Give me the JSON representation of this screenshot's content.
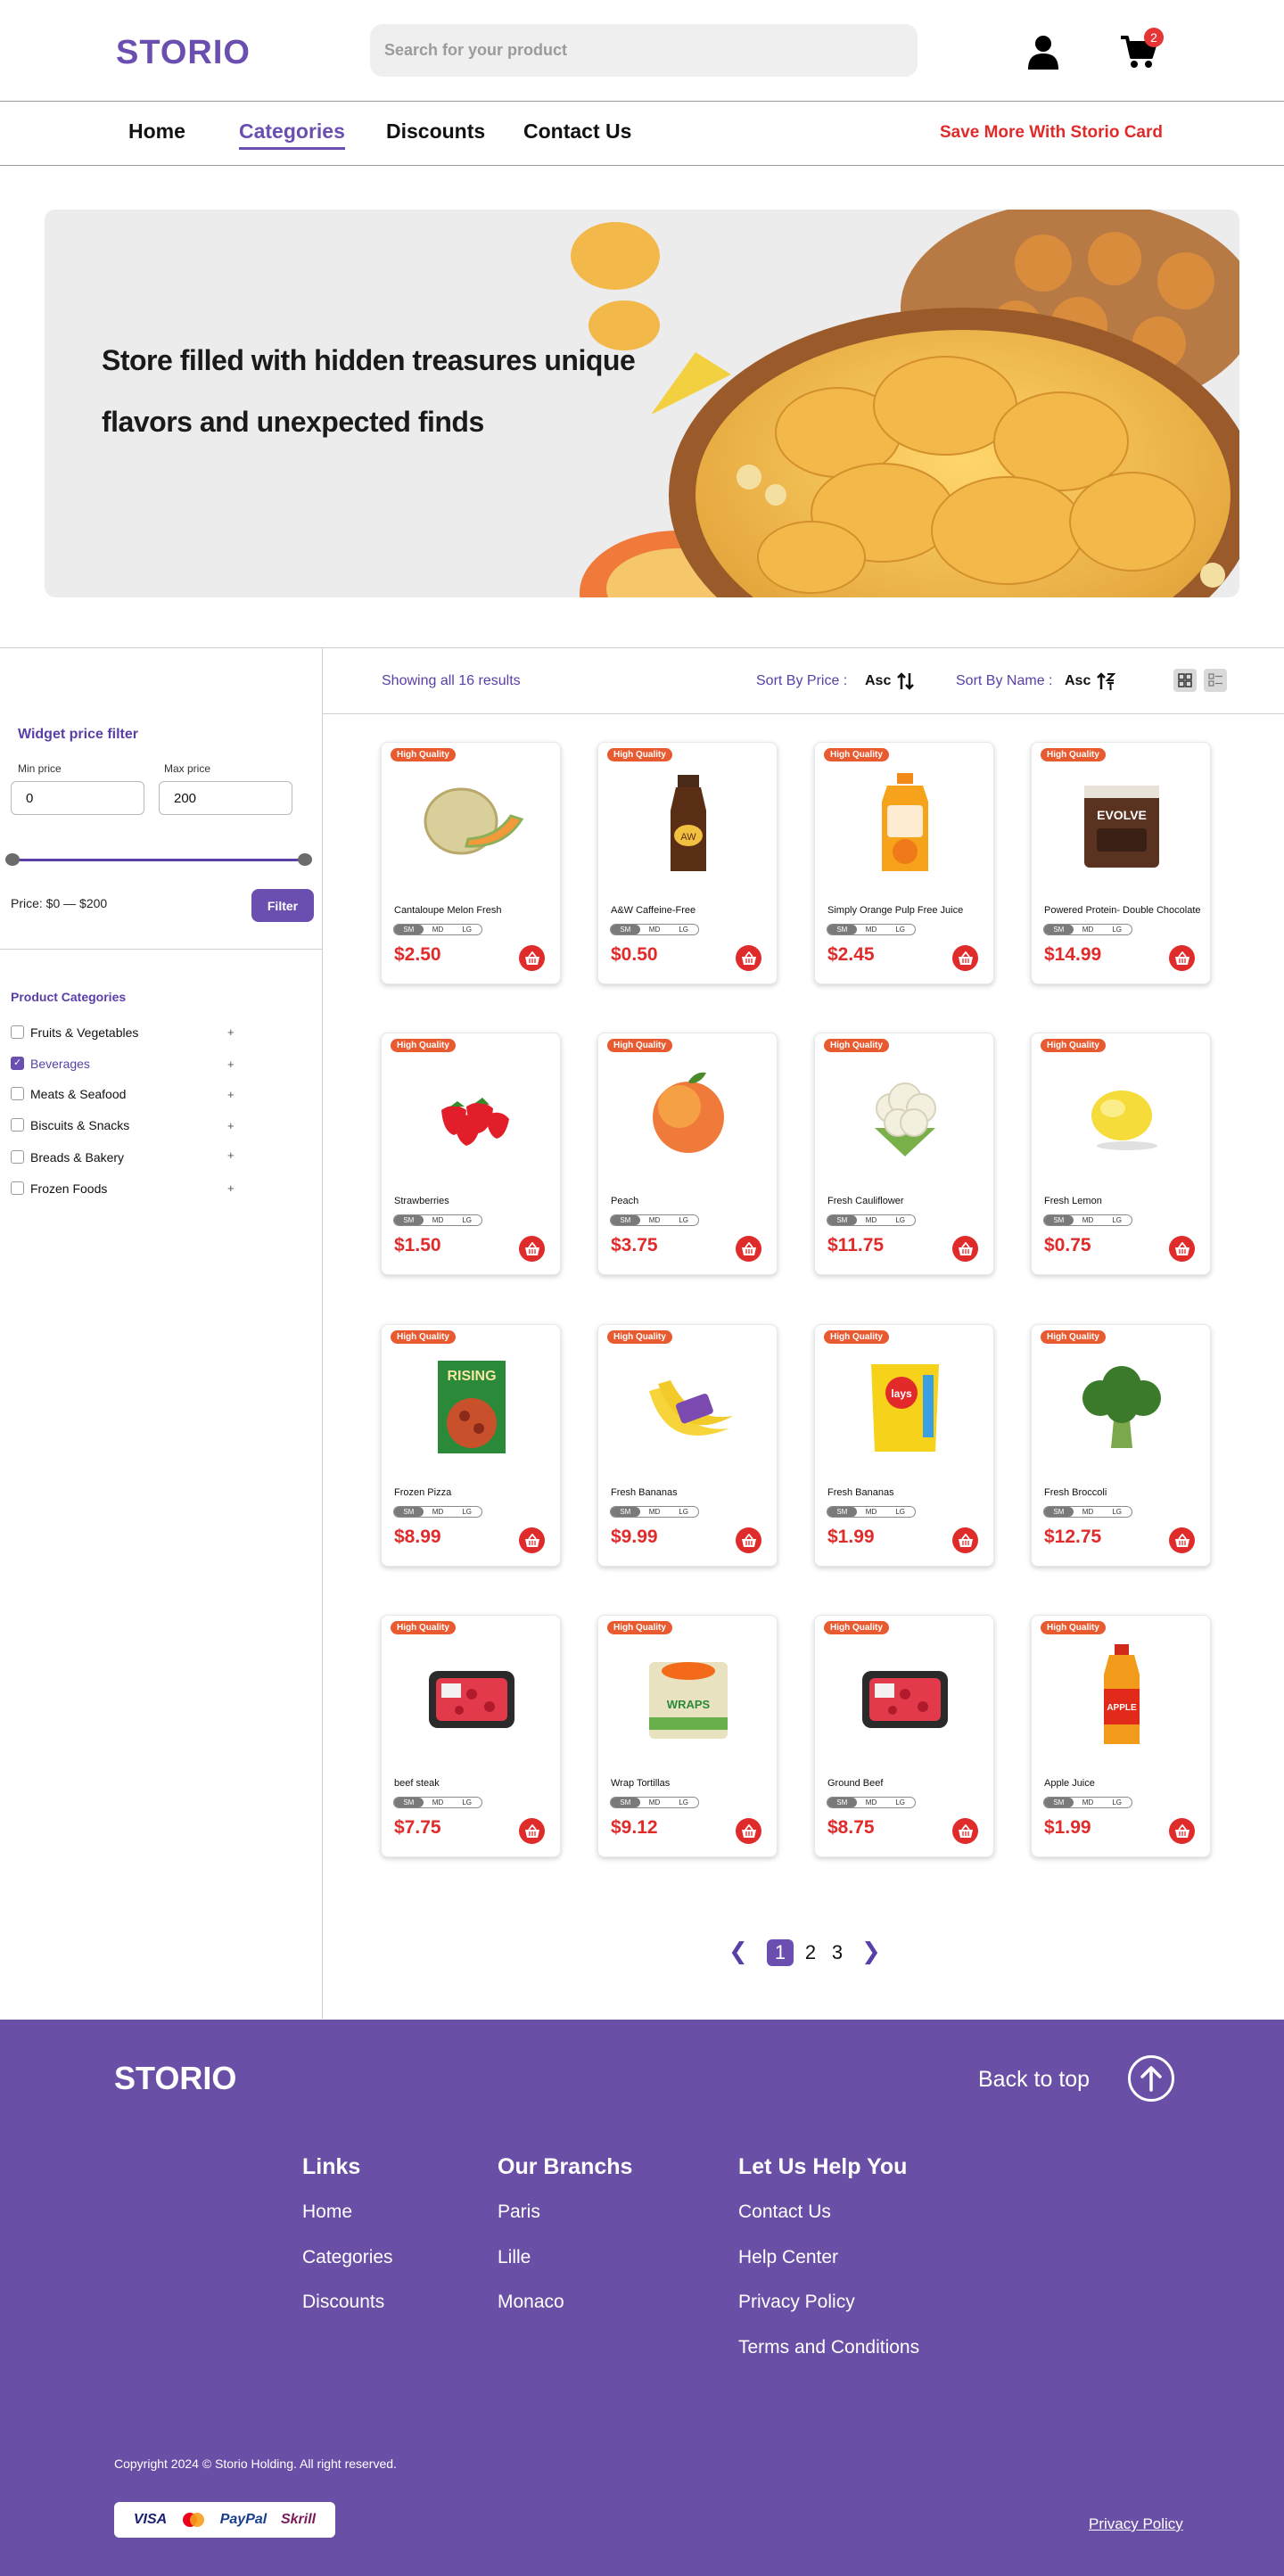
{
  "header": {
    "logo": "STORIO",
    "search_placeholder": "Search for your product",
    "cart_count": "2"
  },
  "nav": {
    "items": [
      "Home",
      "Categories",
      "Discounts",
      "Contact Us"
    ],
    "active": "Categories",
    "promo": "Save More With Storio Card"
  },
  "hero": {
    "line1": "Store filled with hidden treasures unique",
    "line2": "flavors  and unexpected finds"
  },
  "filter": {
    "title": "Widget price filter",
    "min_label": "Min price",
    "max_label": "Max price",
    "min_value": "0",
    "max_value": "200",
    "range_text": "Price: $0 — $200",
    "button": "Filter"
  },
  "categories": {
    "title": "Product Categories",
    "items": [
      {
        "label": "Fruits & Vegetables",
        "checked": false
      },
      {
        "label": "Beverages",
        "checked": true
      },
      {
        "label": "Meats & Seafood",
        "checked": false
      },
      {
        "label": "Biscuits & Snacks",
        "checked": false
      },
      {
        "label": "Breads & Bakery",
        "checked": false
      },
      {
        "label": "Frozen Foods",
        "checked": false
      }
    ]
  },
  "toolbar": {
    "showing": "Showing all 16 results",
    "sort_price_label": "Sort  By Price :",
    "sort_price_value": "Asc",
    "sort_name_label": "Sort  By Name :",
    "sort_name_value": "Asc"
  },
  "badge_text": "High Quality",
  "sizes": [
    "SM",
    "MD",
    "LG"
  ],
  "products": [
    {
      "name": "Cantaloupe Melon Fresh",
      "price": "$2.50",
      "icon": "melon"
    },
    {
      "name": "A&W Caffeine-Free",
      "price": "$0.50",
      "icon": "soda-bottle"
    },
    {
      "name": "Simply Orange Pulp Free Juice",
      "price": "$2.45",
      "icon": "juice-jug"
    },
    {
      "name": "Powered Protein- Double Chocolate",
      "price": "$14.99",
      "icon": "protein-pack"
    },
    {
      "name": "Strawberries",
      "price": "$1.50",
      "icon": "strawberries"
    },
    {
      "name": "Peach",
      "price": "$3.75",
      "icon": "peach"
    },
    {
      "name": "Fresh Cauliflower",
      "price": "$11.75",
      "icon": "cauliflower"
    },
    {
      "name": "Fresh Lemon",
      "price": "$0.75",
      "icon": "lemon"
    },
    {
      "name": "Frozen Pizza",
      "price": "$8.99",
      "icon": "pizza-box"
    },
    {
      "name": "Fresh Bananas",
      "price": "$9.99",
      "icon": "bananas"
    },
    {
      "name": "Fresh Bananas",
      "price": "$1.99",
      "icon": "chips-bag"
    },
    {
      "name": "Fresh Broccoli",
      "price": "$12.75",
      "icon": "broccoli"
    },
    {
      "name": "beef steak",
      "price": "$7.75",
      "icon": "meat-tray"
    },
    {
      "name": "Wrap Tortillas",
      "price": "$9.12",
      "icon": "tortilla-pack"
    },
    {
      "name": "Ground Beef",
      "price": "$8.75",
      "icon": "meat-tray"
    },
    {
      "name": "Apple Juice",
      "price": "$1.99",
      "icon": "juice-bottle"
    }
  ],
  "pagination": {
    "pages": [
      "1",
      "2",
      "3"
    ],
    "active": "1"
  },
  "footer": {
    "logo": "STORIO",
    "back_to_top": "Back to top",
    "columns": [
      {
        "title": "Links",
        "links": [
          "Home",
          "Categories",
          "Discounts"
        ]
      },
      {
        "title": "Our Branchs",
        "links": [
          "Paris",
          "Lille",
          "Monaco"
        ]
      },
      {
        "title": "Let Us Help You",
        "links": [
          "Contact Us",
          "Help Center",
          "Privacy Policy",
          "Terms and Conditions"
        ]
      }
    ],
    "copyright": "Copyright 2024 © Storio Holding. All right reserved.",
    "payments": [
      "VISA",
      "PayPal",
      "Skrill"
    ],
    "privacy": "Privacy Policy"
  },
  "colors": {
    "brand": "#6a4fb0",
    "price": "#e02b2b",
    "badge": "#e85a2f",
    "footer": "#6a4fa6"
  }
}
